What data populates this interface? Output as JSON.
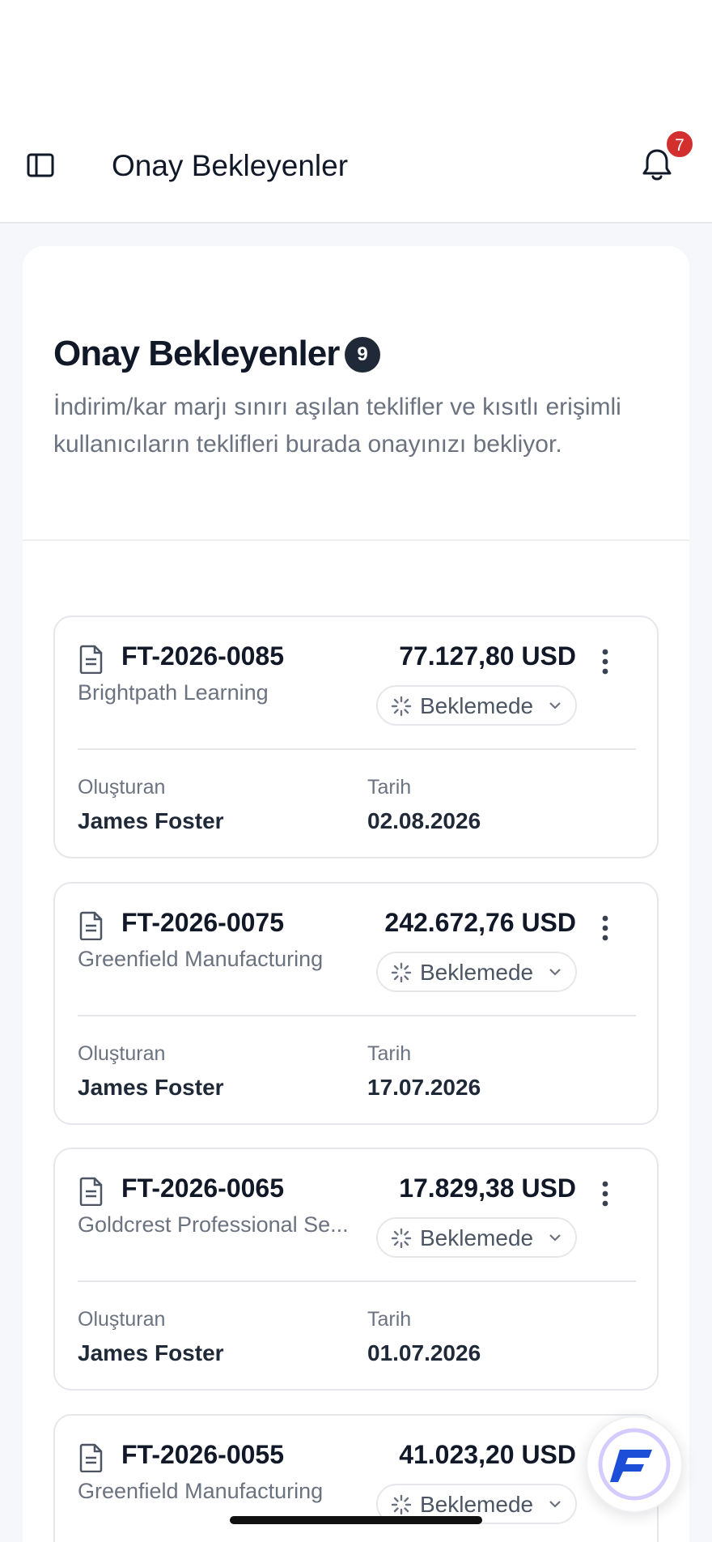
{
  "topbar": {
    "title": "Onay Bekleyenler",
    "notification_count": "7"
  },
  "header": {
    "title": "Onay Bekleyenler",
    "count": "9",
    "description": "İndirim/kar marjı sınırı aşılan teklifler ve kısıtlı erişimli kullanıcıların teklifleri burada onayınızı bekliyor."
  },
  "labels": {
    "creator": "Oluşturan",
    "date": "Tarih"
  },
  "offers": [
    {
      "id": "FT-2026-0085",
      "customer": "Brightpath Learning",
      "amount": "77.127,80 USD",
      "status": "Beklemede",
      "creator": "James Foster",
      "date": "02.08.2026"
    },
    {
      "id": "FT-2026-0075",
      "customer": "Greenfield Manufacturing",
      "amount": "242.672,76 USD",
      "status": "Beklemede",
      "creator": "James Foster",
      "date": "17.07.2026"
    },
    {
      "id": "FT-2026-0065",
      "customer": "Goldcrest Professional Se...",
      "amount": "17.829,38 USD",
      "status": "Beklemede",
      "creator": "James Foster",
      "date": "01.07.2026"
    },
    {
      "id": "FT-2026-0055",
      "customer": "Greenfield Manufacturing",
      "amount": "41.023,20 USD",
      "status": "Beklemede",
      "creator": "",
      "date": ""
    }
  ],
  "colors": {
    "accent": "#1f2937",
    "notification_badge": "#d32f2f",
    "fab_brand": "#1d4ed8"
  },
  "icons": {
    "sidebar": "sidebar-toggle-icon",
    "bell": "bell-icon",
    "document": "document-icon",
    "status": "loader-icon",
    "more": "more-vertical-icon"
  }
}
